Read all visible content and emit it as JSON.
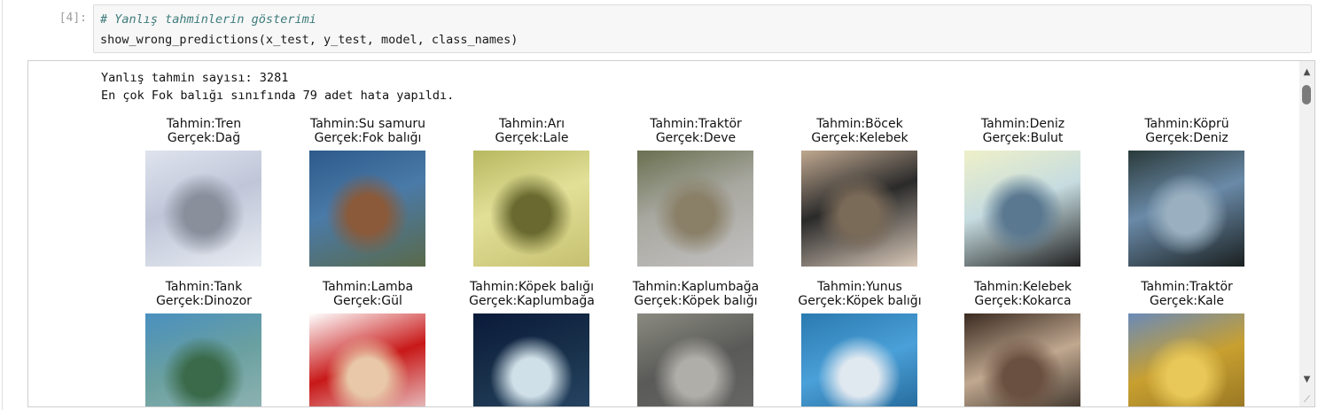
{
  "cell": {
    "prompt": "[4]:",
    "code_lines": [
      "# Yanlış tahminlerin gösterimi",
      "show_wrong_predictions(x_test, y_test, model, class_names)"
    ]
  },
  "output": {
    "stdout": [
      "Yanlış tahmin sayısı: 3281",
      "En çok Fok balığı sınıfında 79 adet hata yapıldı."
    ],
    "predictions": [
      {
        "pred": "Tahmin:Tren",
        "true": "Gerçek:Dağ",
        "colors": [
          "#dfe3ee",
          "#bfc6d8",
          "#8a8f9c",
          "#e8ecf2"
        ]
      },
      {
        "pred": "Tahmin:Su samuru",
        "true": "Gerçek:Fok balığı",
        "colors": [
          "#2d5a8a",
          "#4a7aa8",
          "#8a5a3a",
          "#5a6a4a"
        ]
      },
      {
        "pred": "Tahmin:Arı",
        "true": "Gerçek:Lale",
        "colors": [
          "#b8b860",
          "#e2e098",
          "#6a6a30",
          "#c6c070"
        ]
      },
      {
        "pred": "Tahmin:Traktör",
        "true": "Gerçek:Deve",
        "colors": [
          "#6a7050",
          "#a8a8a0",
          "#8a8068",
          "#c2c0c0"
        ]
      },
      {
        "pred": "Tahmin:Böcek",
        "true": "Gerçek:Kelebek",
        "colors": [
          "#c0a890",
          "#2a2a2a",
          "#7a6a58",
          "#d8c8b8"
        ]
      },
      {
        "pred": "Tahmin:Deniz",
        "true": "Gerçek:Bulut",
        "colors": [
          "#eef0c8",
          "#c6dce0",
          "#5a7890",
          "#202020"
        ]
      },
      {
        "pred": "Tahmin:Köprü",
        "true": "Gerçek:Deniz",
        "colors": [
          "#2a3a3a",
          "#6a8aa8",
          "#9ab0c0",
          "#1a2020"
        ]
      },
      {
        "pred": "Tahmin:Tank",
        "true": "Gerçek:Dinozor",
        "colors": [
          "#4a90c0",
          "#6aa0a0",
          "#3a6a4a",
          "#9ab8b8"
        ]
      },
      {
        "pred": "Tahmin:Lamba",
        "true": "Gerçek:Gül",
        "colors": [
          "#ffffff",
          "#c81818",
          "#e8c8a8",
          "#f0f0f0"
        ]
      },
      {
        "pred": "Tahmin:Köpek balığı",
        "true": "Gerçek:Kaplumbağa",
        "colors": [
          "#0a1a3a",
          "#18304a",
          "#d0e0e8",
          "#2a4a6a"
        ]
      },
      {
        "pred": "Tahmin:Kaplumbağa",
        "true": "Gerçek:Köpek balığı",
        "colors": [
          "#8a8a80",
          "#5a5a58",
          "#b0aea8",
          "#6a6a68"
        ]
      },
      {
        "pred": "Tahmin:Yunus",
        "true": "Gerçek:Köpek balığı",
        "colors": [
          "#2a7ab0",
          "#4aa0d8",
          "#e0e8f0",
          "#1a5a8a"
        ]
      },
      {
        "pred": "Tahmin:Kelebek",
        "true": "Gerçek:Kokarca",
        "colors": [
          "#3a2a20",
          "#c0a890",
          "#6a5040",
          "#1a1410"
        ]
      },
      {
        "pred": "Tahmin:Traktör",
        "true": "Gerçek:Kale",
        "colors": [
          "#6a8ab8",
          "#c8a030",
          "#e8c858",
          "#8a6a20"
        ]
      }
    ]
  }
}
